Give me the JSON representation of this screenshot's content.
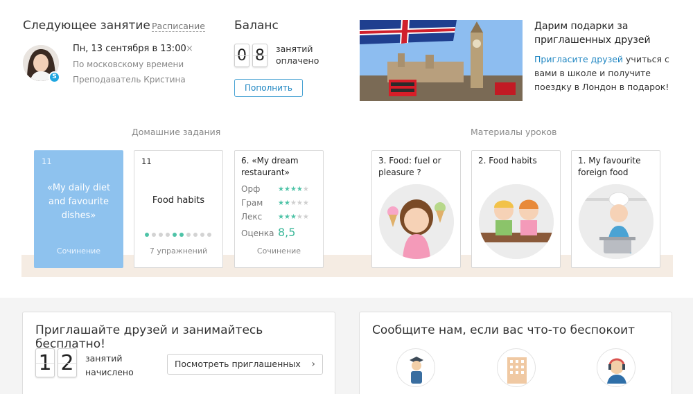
{
  "next_lesson": {
    "title": "Следующее занятие",
    "schedule_link": "Расписание",
    "date": "Пн, 13 сентября в 13:00",
    "close": "×",
    "timezone": "По московскому времени",
    "teacher": "Преподаватель Кристина",
    "skype_glyph": "S"
  },
  "balance": {
    "title": "Баланс",
    "digits": [
      "0",
      "8"
    ],
    "line1": "занятий",
    "line2": "оплачено",
    "refill_button": "Пополнить"
  },
  "promo": {
    "title": "Дарим подарки за приглашенных друзей",
    "link": "Пригласите друзей",
    "text": " учиться с вами в школе и получите поездку в Лондон в подарок!"
  },
  "homework": {
    "label": "Домашние задания",
    "cards": [
      {
        "num": "11",
        "quote": "«My daily diet and favourite dishes»",
        "footer": "Сочинение"
      },
      {
        "num": "11",
        "title": "Food habits",
        "footer": "7 упражнений",
        "dots_done": [
          true,
          false,
          false,
          false,
          true,
          true,
          false,
          false,
          false,
          false
        ]
      },
      {
        "title": "6. «My dream restaurant»",
        "ratings": [
          {
            "label": "Орф",
            "stars": 4
          },
          {
            "label": "Грам",
            "stars": 2
          },
          {
            "label": "Лекс",
            "stars": 3
          }
        ],
        "score_label": "Оценка",
        "score": "8,5",
        "footer": "Сочинение"
      }
    ]
  },
  "materials": {
    "label": "Материалы уроков",
    "cards": [
      {
        "title": "3. Food: fuel or pleasure ?"
      },
      {
        "title": "2. Food habits"
      },
      {
        "title": "1. My favourite foreign food"
      }
    ]
  },
  "invite_box": {
    "title": "Приглашайте друзей и занимайтесь бесплатно!",
    "digits": [
      "1",
      "2"
    ],
    "line1": "занятий",
    "line2": "начислено",
    "button": "Посмотреть приглашенных",
    "chevron": "›"
  },
  "feedback_box": {
    "title": "Сообщите нам, если вас что-то беспокоит",
    "icons": [
      "teacher-icon",
      "building-icon",
      "support-agent-icon"
    ]
  },
  "colors": {
    "accent_blue": "#1f86c2",
    "green": "#4ec3a7",
    "card_blue": "#8ec2ee",
    "shelf": "#f5ece3"
  }
}
